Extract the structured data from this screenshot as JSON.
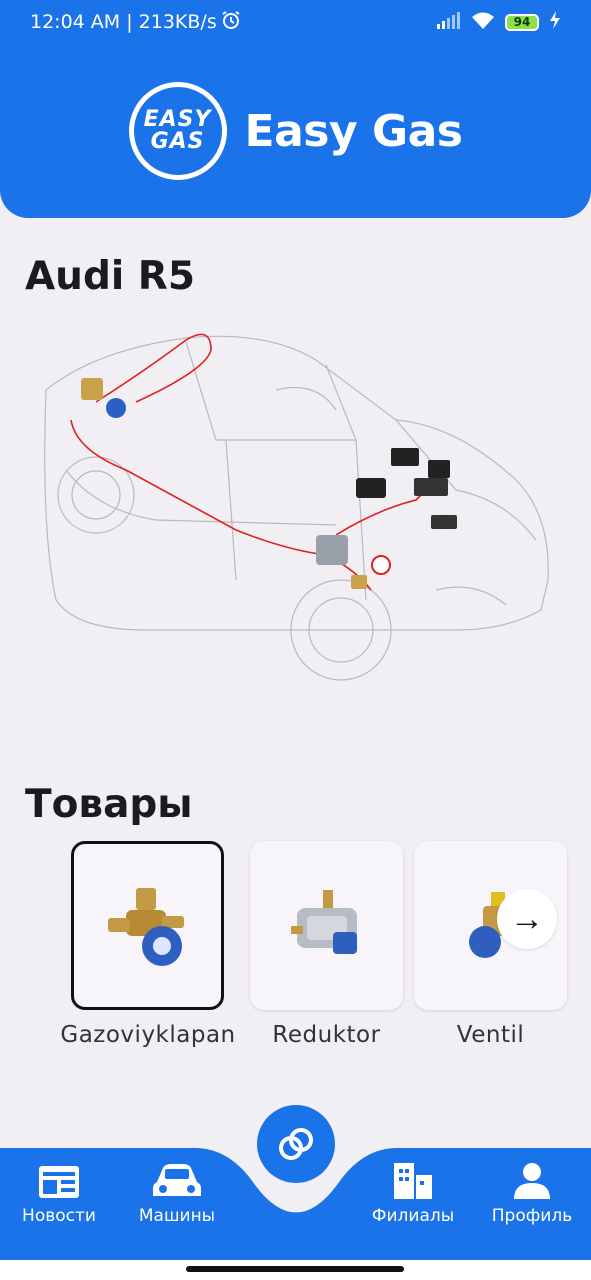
{
  "status_bar": {
    "time_speed": "12:04 AM | 213KB/s",
    "battery": "94"
  },
  "header": {
    "logo_top": "EASY",
    "logo_bottom": "GAS",
    "title": "Easy Gas"
  },
  "car": {
    "title": "Audi R5"
  },
  "products": {
    "title": "Товары",
    "items": [
      {
        "label": "Gazoviyklapan"
      },
      {
        "label": "Reduktor"
      },
      {
        "label": "Ventil"
      }
    ],
    "next_arrow": "→"
  },
  "bottom_nav": {
    "items": [
      {
        "label": "Новости"
      },
      {
        "label": "Машины"
      },
      {
        "label": "Филиалы"
      },
      {
        "label": "Профиль"
      }
    ]
  },
  "colors": {
    "primary": "#1a73e8",
    "background": "#f1eef4"
  }
}
